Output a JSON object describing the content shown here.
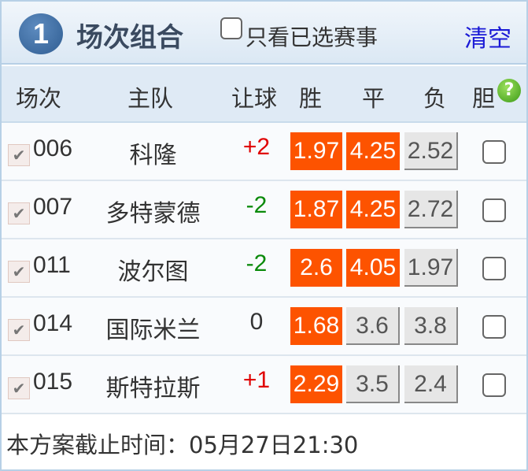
{
  "header": {
    "step": "1",
    "title": "场次组合",
    "only_selected_label": "只看已选赛事",
    "clear_label": "清空"
  },
  "columns": {
    "match": "场次",
    "home": "主队",
    "handicap": "让球",
    "win": "胜",
    "draw": "平",
    "lose": "负",
    "banker": "胆",
    "help_icon": "?"
  },
  "colors": {
    "selected": "#fd5300",
    "positive": "#e00000",
    "negative": "#0a8a0a"
  },
  "rows": [
    {
      "no": "006",
      "team": "科隆",
      "handicap": "+2",
      "win": "1.97",
      "draw": "4.25",
      "lose": "2.52",
      "sel": [
        true,
        true,
        false
      ]
    },
    {
      "no": "007",
      "team": "多特蒙德",
      "handicap": "-2",
      "win": "1.87",
      "draw": "4.25",
      "lose": "2.72",
      "sel": [
        true,
        true,
        false
      ]
    },
    {
      "no": "011",
      "team": "波尔图",
      "handicap": "-2",
      "win": "2.6",
      "draw": "4.05",
      "lose": "1.97",
      "sel": [
        true,
        true,
        false
      ]
    },
    {
      "no": "014",
      "team": "国际米兰",
      "handicap": "0",
      "win": "1.68",
      "draw": "3.6",
      "lose": "3.8",
      "sel": [
        true,
        false,
        false
      ]
    },
    {
      "no": "015",
      "team": "斯特拉斯",
      "handicap": "+1",
      "win": "2.29",
      "draw": "3.5",
      "lose": "2.4",
      "sel": [
        true,
        false,
        false
      ]
    }
  ],
  "footer": {
    "deadline": "本方案截止时间：05月27日21:30"
  }
}
